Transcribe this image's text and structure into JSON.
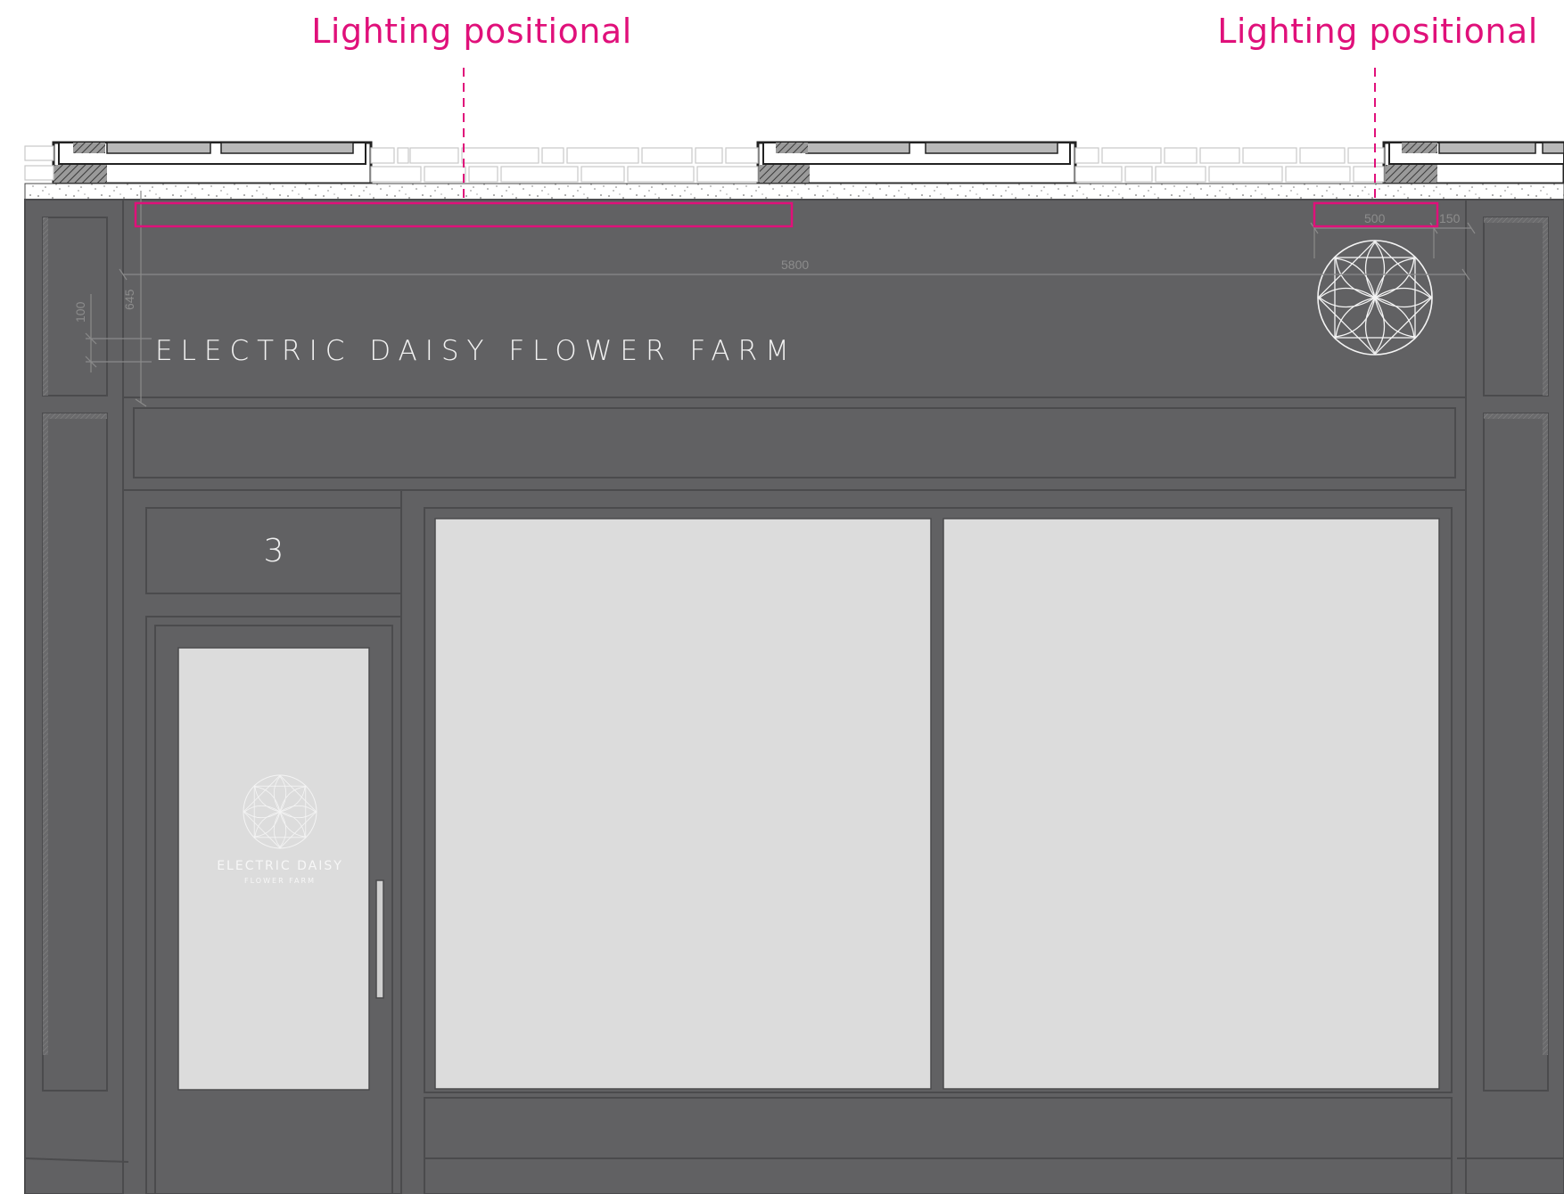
{
  "callouts": [
    {
      "label": "Lighting positional"
    },
    {
      "label": "Lighting positional"
    }
  ],
  "fascia": {
    "sign_text": "ELECTRIC DAISY FLOWER FARM",
    "logo_icon": "daisy-mandala-icon"
  },
  "dimensions": {
    "overall_width": "5800",
    "sign_height": "645",
    "text_height": "100",
    "logo_width": "500",
    "logo_offset": "150"
  },
  "door": {
    "street_number": "3",
    "vinyl_brand": "ELECTRIC DAISY",
    "vinyl_sub": "FLOWER FARM",
    "logo_icon": "daisy-mandala-icon"
  },
  "colors": {
    "shopfront": "#616163",
    "glass": "#dcdcdc",
    "accent": "#e0107a",
    "brick_line": "#cfcfcf",
    "hatch": "#555555"
  }
}
